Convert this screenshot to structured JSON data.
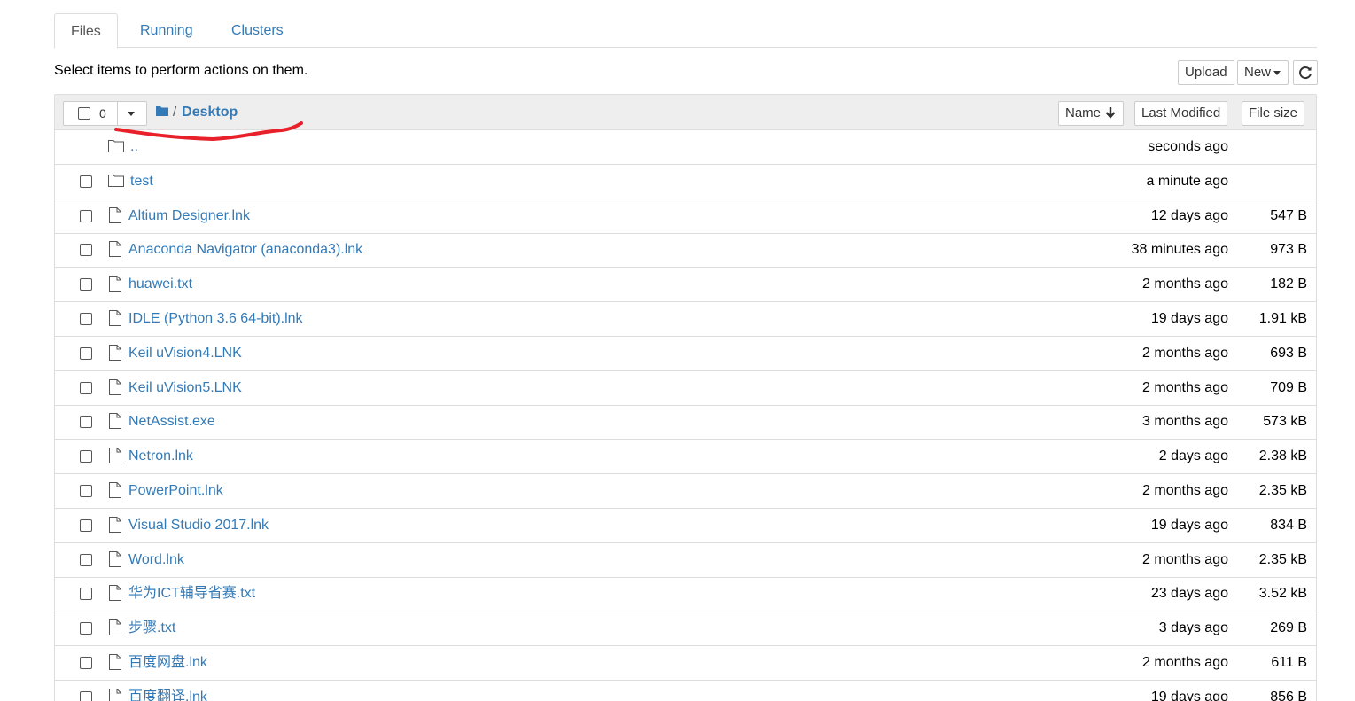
{
  "tabs": [
    {
      "label": "Files",
      "active": true
    },
    {
      "label": "Running",
      "active": false
    },
    {
      "label": "Clusters",
      "active": false
    }
  ],
  "hint": "Select items to perform actions on them.",
  "toolbar": {
    "upload_label": "Upload",
    "new_label": "New",
    "refresh_icon": "refresh-icon"
  },
  "list_header": {
    "selected_count": "0",
    "breadcrumb_root_icon": "folder-icon",
    "breadcrumb_sep": "/",
    "breadcrumb_current": "Desktop",
    "sort_name_label": "Name",
    "sort_modified_label": "Last Modified",
    "sort_size_label": "File size"
  },
  "annotation": {
    "color": "#e8202a"
  },
  "items": [
    {
      "type": "parent",
      "name": "..",
      "modified": "seconds ago",
      "size": ""
    },
    {
      "type": "folder",
      "name": "test",
      "modified": "a minute ago",
      "size": ""
    },
    {
      "type": "file",
      "name": "Altium Designer.lnk",
      "modified": "12 days ago",
      "size": "547 B"
    },
    {
      "type": "file",
      "name": "Anaconda Navigator (anaconda3).lnk",
      "modified": "38 minutes ago",
      "size": "973 B"
    },
    {
      "type": "file",
      "name": "huawei.txt",
      "modified": "2 months ago",
      "size": "182 B"
    },
    {
      "type": "file",
      "name": "IDLE (Python 3.6 64-bit).lnk",
      "modified": "19 days ago",
      "size": "1.91 kB"
    },
    {
      "type": "file",
      "name": "Keil uVision4.LNK",
      "modified": "2 months ago",
      "size": "693 B"
    },
    {
      "type": "file",
      "name": "Keil uVision5.LNK",
      "modified": "2 months ago",
      "size": "709 B"
    },
    {
      "type": "file",
      "name": "NetAssist.exe",
      "modified": "3 months ago",
      "size": "573 kB"
    },
    {
      "type": "file",
      "name": "Netron.lnk",
      "modified": "2 days ago",
      "size": "2.38 kB"
    },
    {
      "type": "file",
      "name": "PowerPoint.lnk",
      "modified": "2 months ago",
      "size": "2.35 kB"
    },
    {
      "type": "file",
      "name": "Visual Studio 2017.lnk",
      "modified": "19 days ago",
      "size": "834 B"
    },
    {
      "type": "file",
      "name": "Word.lnk",
      "modified": "2 months ago",
      "size": "2.35 kB"
    },
    {
      "type": "file",
      "name": "华为ICT辅导省赛.txt",
      "modified": "23 days ago",
      "size": "3.52 kB"
    },
    {
      "type": "file",
      "name": "步骤.txt",
      "modified": "3 days ago",
      "size": "269 B"
    },
    {
      "type": "file",
      "name": "百度网盘.lnk",
      "modified": "2 months ago",
      "size": "611 B"
    },
    {
      "type": "file",
      "name": "百度翻译.lnk",
      "modified": "19 days ago",
      "size": "856 B"
    }
  ]
}
